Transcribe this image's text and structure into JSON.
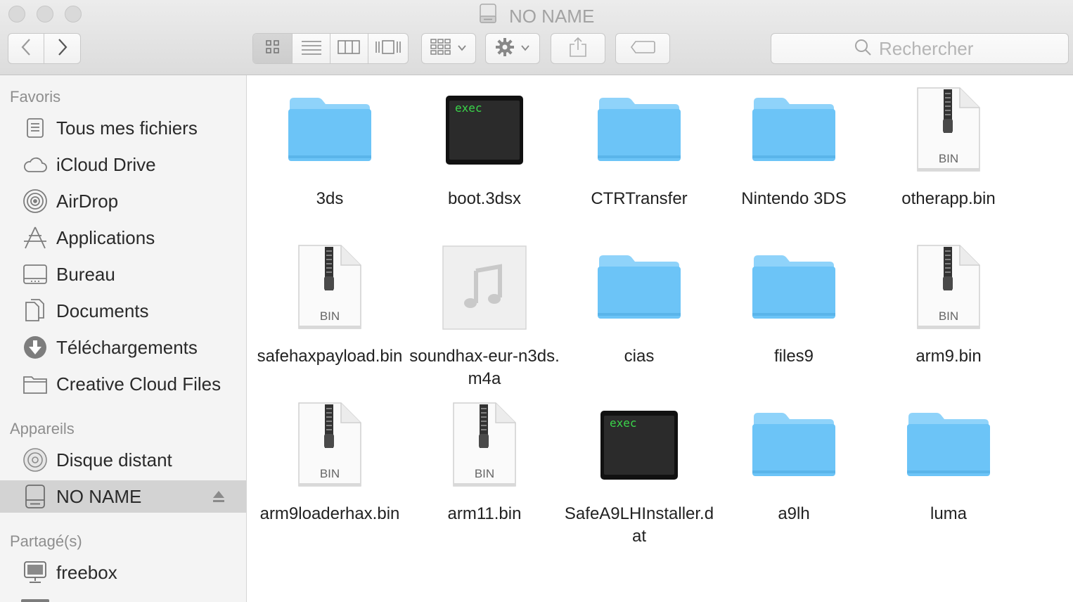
{
  "window": {
    "title": "NO NAME",
    "icon": "external-disk-icon"
  },
  "toolbar": {
    "back": "chevron-left-icon",
    "forward": "chevron-right-icon",
    "view_modes": [
      "icon-view-icon",
      "list-view-icon",
      "column-view-icon",
      "coverflow-view-icon"
    ],
    "active_view": 0,
    "arrange": "arrange-grid-icon",
    "action": "gear-icon",
    "share": "share-icon",
    "tag": "tag-icon",
    "search_placeholder": "Rechercher"
  },
  "sidebar": {
    "sections": [
      {
        "title": "Favoris",
        "items": [
          {
            "label": "Tous mes fichiers",
            "icon": "all-files-icon"
          },
          {
            "label": "iCloud Drive",
            "icon": "cloud-icon"
          },
          {
            "label": "AirDrop",
            "icon": "airdrop-icon"
          },
          {
            "label": "Applications",
            "icon": "applications-icon"
          },
          {
            "label": "Bureau",
            "icon": "desktop-icon"
          },
          {
            "label": "Documents",
            "icon": "documents-icon"
          },
          {
            "label": "Téléchargements",
            "icon": "downloads-icon"
          },
          {
            "label": "Creative Cloud Files",
            "icon": "folder-icon"
          }
        ]
      },
      {
        "title": "Appareils",
        "items": [
          {
            "label": "Disque distant",
            "icon": "disc-icon"
          },
          {
            "label": "NO NAME",
            "icon": "external-disk-icon",
            "selected": true,
            "eject": "eject-icon"
          }
        ]
      },
      {
        "title": "Partagé(s)",
        "items": [
          {
            "label": "freebox",
            "icon": "network-computer-icon"
          }
        ]
      }
    ]
  },
  "files": [
    {
      "name": "3ds",
      "type": "folder"
    },
    {
      "name": "boot.3dsx",
      "type": "exec",
      "badge": "exec"
    },
    {
      "name": "CTRTransfer",
      "type": "folder"
    },
    {
      "name": "Nintendo 3DS",
      "type": "folder"
    },
    {
      "name": "otherapp.bin",
      "type": "bin",
      "badge": "BIN"
    },
    {
      "name": "safehaxpayload.bin",
      "type": "bin",
      "badge": "BIN"
    },
    {
      "name": "soundhax-eur-n3ds.m4a",
      "type": "audio"
    },
    {
      "name": "cias",
      "type": "folder"
    },
    {
      "name": "files9",
      "type": "folder"
    },
    {
      "name": "arm9.bin",
      "type": "bin",
      "badge": "BIN"
    },
    {
      "name": "arm9loaderhax.bin",
      "type": "bin",
      "badge": "BIN"
    },
    {
      "name": "arm11.bin",
      "type": "bin",
      "badge": "BIN"
    },
    {
      "name": "SafeA9LHInstaller.dat",
      "type": "exec",
      "badge": "exec"
    },
    {
      "name": "a9lh",
      "type": "folder"
    },
    {
      "name": "luma",
      "type": "folder"
    }
  ],
  "colors": {
    "folder": "#6cc4f7",
    "folder_tab": "#8fd3fa",
    "exec_text": "#3ad64a",
    "sidebar_selected": "#d3d3d3"
  }
}
